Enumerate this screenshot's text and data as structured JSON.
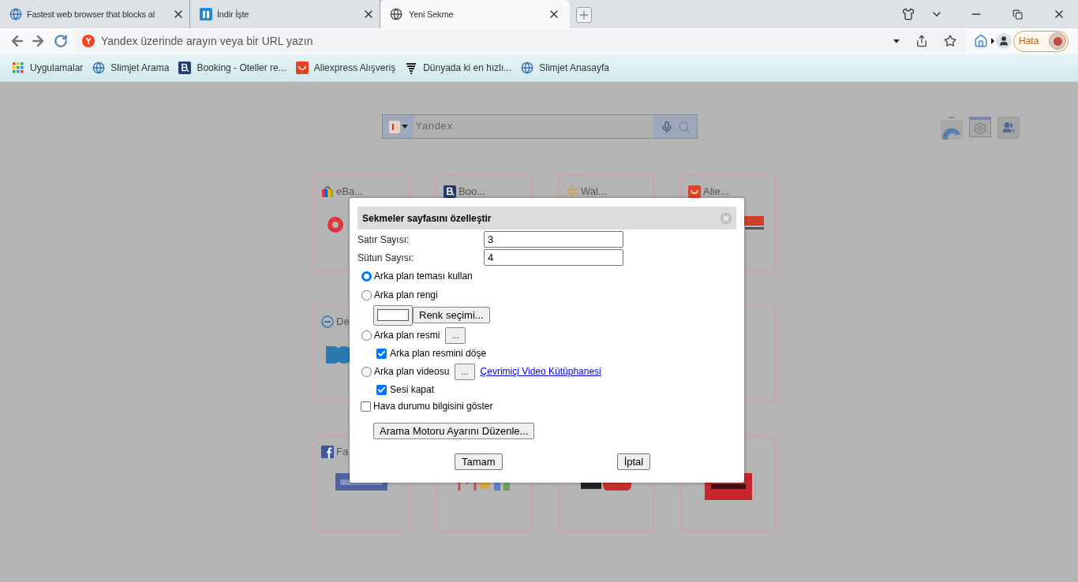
{
  "tabs": [
    {
      "title": "Fastest web browser that blocks al",
      "selected": false
    },
    {
      "title": "İndir İşte",
      "selected": false
    },
    {
      "title": "Yeni Sekme",
      "selected": true
    }
  ],
  "address_bar": {
    "placeholder": "Yandex üzerinde arayın veya bir URL yazın"
  },
  "profile_button": {
    "label": "Hata"
  },
  "bookmarks": [
    {
      "label": "Uygulamalar"
    },
    {
      "label": "Slimjet Arama"
    },
    {
      "label": "Booking - Oteller re..."
    },
    {
      "label": "Aliexpress Alışveriş"
    },
    {
      "label": "Dünyada ki en hızlı..."
    },
    {
      "label": "Slimjet Anasayfa"
    }
  ],
  "search": {
    "placeholder": "Yandex"
  },
  "tiles": [
    {
      "label": "eBa..."
    },
    {
      "label": "Boo..."
    },
    {
      "label": "Wal..."
    },
    {
      "label": "Alie..."
    },
    {
      "label": "De"
    },
    {
      "label": "Fa"
    }
  ],
  "dialog": {
    "title": "Sekmeler sayfasını özelleştir",
    "fields": [
      {
        "label": "Satır Sayısı:",
        "value": "3"
      },
      {
        "label": "Sütun Sayısı:",
        "value": "4"
      }
    ],
    "options": [
      {
        "kind": "radio",
        "label": "Arka plan teması kullan",
        "selected": true
      },
      {
        "kind": "radio",
        "label": "Arka plan rengi",
        "selected": false
      },
      {
        "kind": "color",
        "button": "Renk seçimi..."
      },
      {
        "kind": "radio",
        "label": "Arka plan resmi",
        "selected": false,
        "button": "..."
      },
      {
        "kind": "sub_checkbox",
        "label": "Arka plan resmini döşe",
        "checked": true
      },
      {
        "kind": "radio",
        "label": "Arka plan videosu",
        "selected": false,
        "button": "...",
        "link": "Çevrimiçi Video Kütüphanesi"
      },
      {
        "kind": "sub_checkbox",
        "label": "Sesi kapat",
        "checked": true
      },
      {
        "kind": "checkbox",
        "label": "Hava durumu bilgisini göster",
        "checked": false
      },
      {
        "kind": "button",
        "label": "Arama Motoru Ayarını Düzenle..."
      }
    ],
    "buttons": [
      "Tamam",
      "İptal"
    ]
  }
}
